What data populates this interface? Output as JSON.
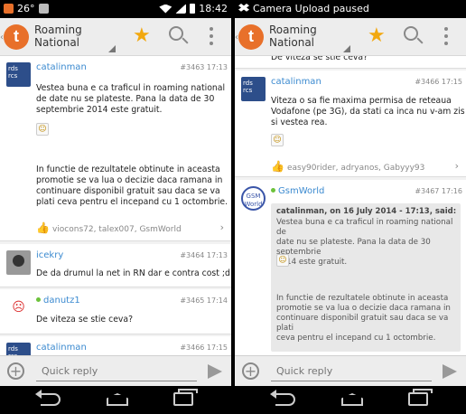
{
  "left": {
    "status": {
      "left_text": "26°",
      "time": "18:42"
    },
    "actionbar": {
      "app_letter": "t",
      "title_line1": "Roaming",
      "title_line2": "National"
    },
    "posts": [
      {
        "user": "catalinman",
        "meta": "#3463  17:13",
        "avatar_text": "rds\nrcs",
        "avatar_sub": "vodafone",
        "text1": "Vestea buna e ca traficul in roaming national\nde date nu se plateste. Pana la data de 30\nseptembrie 2014 este gratuit.",
        "text2": "In functie de rezultatele obtinute in aceasta\npromotie  se va lua o decizie daca ramana in\ncontinuare disponibil gratuit sau daca se va\nplati ceva pentru el incepand cu 1 octombrie.",
        "likes": "viocons72, talex007, GsmWorld"
      },
      {
        "user": "icekry",
        "meta": "#3464  17:13",
        "text1": "De da drumul la net in RN dar e contra cost ;d"
      },
      {
        "user": "danutz1",
        "meta": "#3465  17:14",
        "text1": "De viteza se stie ceva?"
      },
      {
        "user": "catalinman",
        "meta": "#3466  17:15",
        "avatar_text": "rds\nrcs"
      }
    ],
    "quick_reply": "Quick reply"
  },
  "right": {
    "status": {
      "notif": "Camera Upload paused"
    },
    "actionbar": {
      "app_letter": "t",
      "title_line1": "Roaming",
      "title_line2": "National"
    },
    "partial_text": "De viteza se stie ceva?",
    "posts": [
      {
        "user": "catalinman",
        "meta": "#3466  17:15",
        "avatar_text": "rds\nrcs",
        "avatar_sub": "vodafone",
        "text1": "Viteza o sa fie maxima permisa de reteaua\nVodafone (pe 3G), da stati ca inca nu v-am zis\nsi vestea rea.",
        "likes": "easy90rider, adryanos, Gabyyy93"
      },
      {
        "user": "GsmWorld",
        "meta": "#3467  17:16",
        "avatar_text": "GSM\nWorld",
        "quote_head": "catalinman, on 16 July 2014 - 17:13, said:",
        "quote_text1": "Vestea buna e ca traficul in roaming national de\ndate nu se plateste. Pana la data de 30 septembrie\n2014 este gratuit.",
        "quote_text2": "In functie de rezultatele obtinute in aceasta\npromotie  se va lua o decizie daca ramana in\ncontinuare disponibil gratuit sau daca se va plati\nceva pentru el incepand cu 1 octombrie."
      }
    ],
    "quick_reply": "Quick reply"
  },
  "colors": {
    "accent": "#3b8ad0",
    "logo": "#e8702a",
    "star": "#f2a80f"
  },
  "icons": [
    "star-icon",
    "search-icon",
    "overflow-icon",
    "add-icon",
    "send-icon",
    "thumbs-up-icon",
    "chevron-right-icon",
    "back-icon",
    "home-icon",
    "recents-icon",
    "dropbox-icon",
    "wifi-icon",
    "signal-icon",
    "battery-icon"
  ]
}
